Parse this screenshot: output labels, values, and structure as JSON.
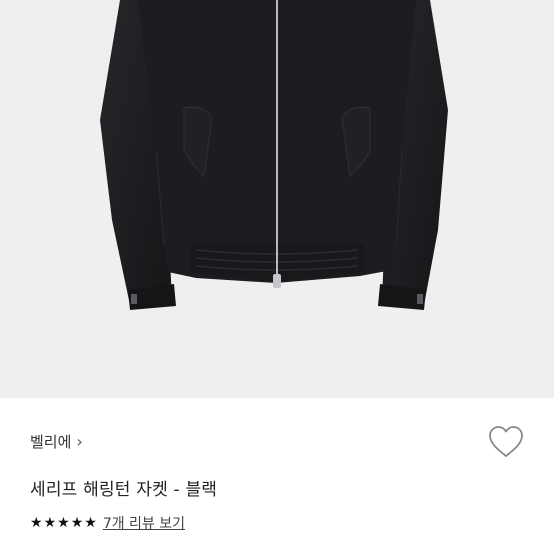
{
  "product": {
    "brand": "벨리에",
    "brand_chevron": "›",
    "title": "세리프 해링턴 자켓 - 블랙",
    "image_alt": "black harrington jacket"
  },
  "rating": {
    "stars": 5,
    "max_stars": 5,
    "review_link": "7개 리뷰 보기"
  },
  "icons": {
    "wishlist": "heart-outline-icon",
    "star": "star-icon"
  },
  "colors": {
    "image_bg": "#efefef",
    "jacket": "#1b1c1e",
    "text": "#222222"
  }
}
